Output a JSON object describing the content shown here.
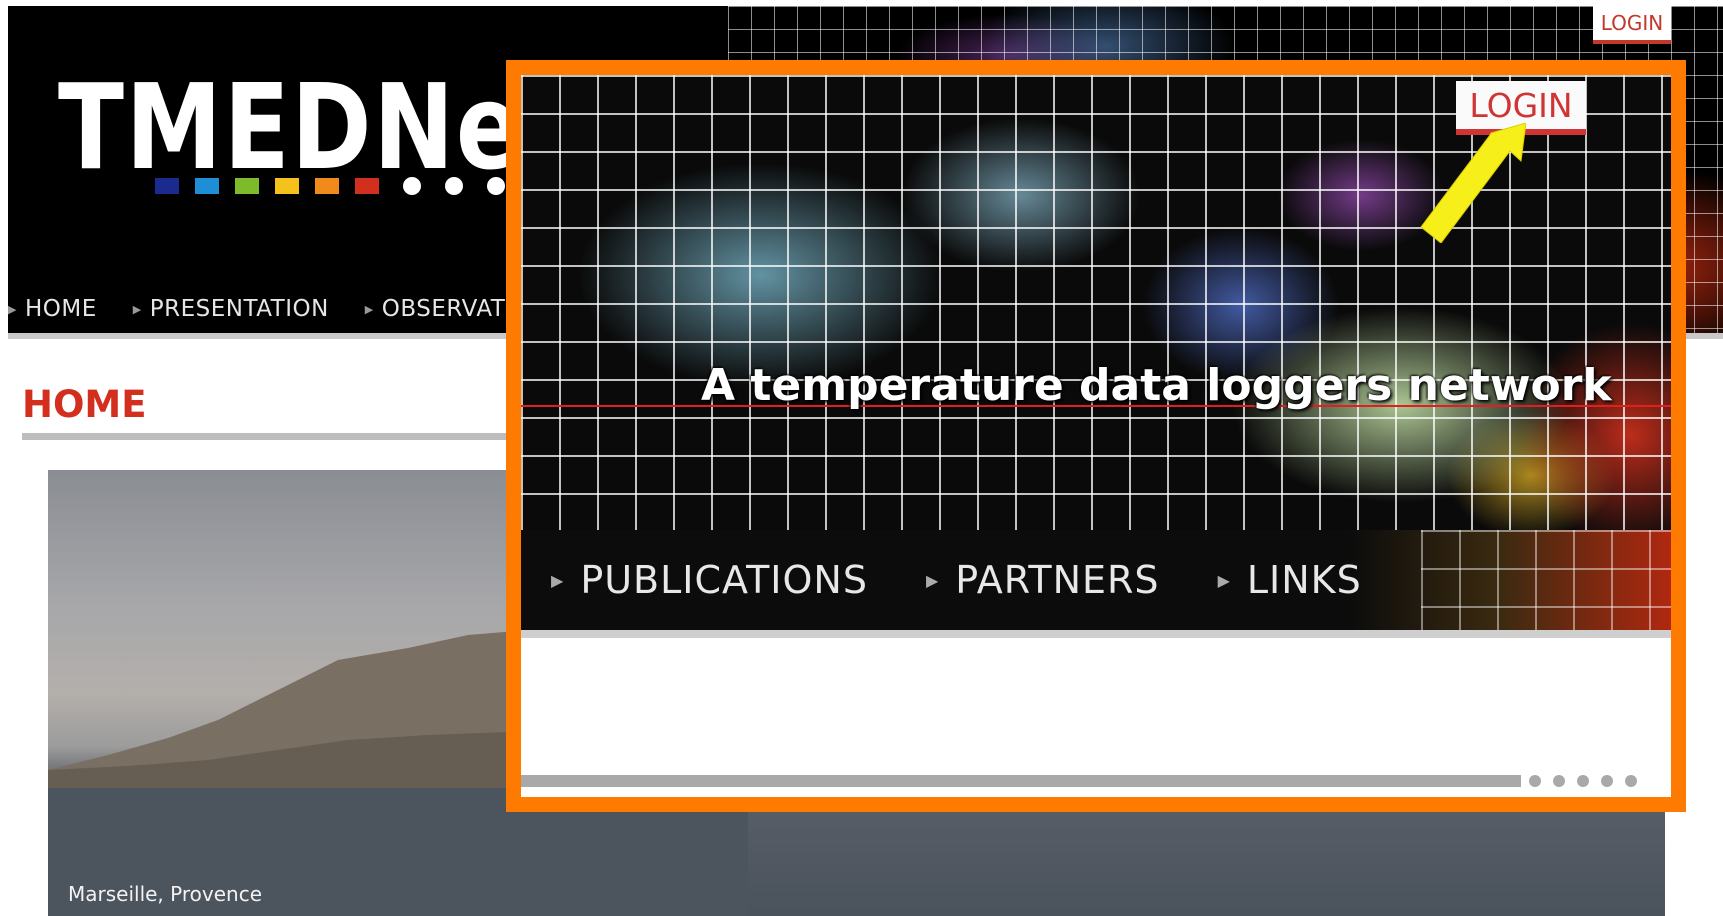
{
  "site": {
    "logo_text": "TMEDNe",
    "logo_colors": [
      "#1b2a8f",
      "#1e8fd6",
      "#7dbb2a",
      "#f4c21a",
      "#f08a1a",
      "#d32f1e"
    ],
    "login_label": "LOGIN",
    "nav": [
      {
        "label": "HOME"
      },
      {
        "label": "PRESENTATION"
      },
      {
        "label": "OBSERVATIO"
      }
    ],
    "page_title": "HOME",
    "photo_caption": "Marseille, Provence"
  },
  "zoom": {
    "border_color": "#ff7a00",
    "tagline": "A temperature data loggers network",
    "login_label": "LOGIN",
    "arrow_color": "#f7ef1a",
    "nav": [
      {
        "label": "PUBLICATIONS"
      },
      {
        "label": "PARTNERS"
      },
      {
        "label": "LINKS"
      }
    ]
  }
}
